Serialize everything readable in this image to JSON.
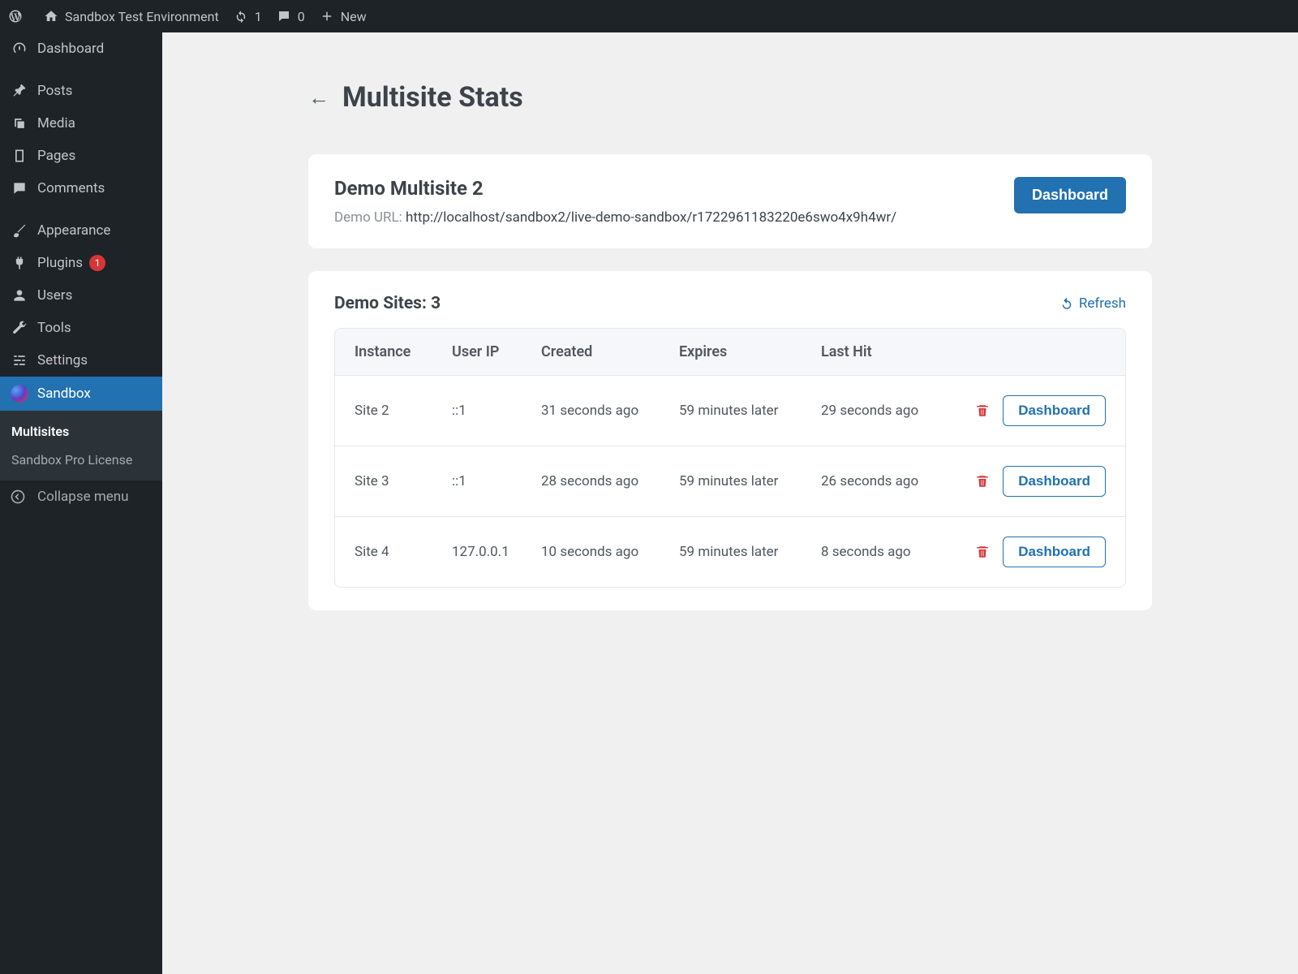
{
  "topbar": {
    "site_name": "Sandbox Test Environment",
    "updates_count": "1",
    "comments_count": "0",
    "new_label": "New"
  },
  "sidebar": {
    "dashboard": "Dashboard",
    "posts": "Posts",
    "media": "Media",
    "pages": "Pages",
    "comments": "Comments",
    "appearance": "Appearance",
    "plugins": "Plugins",
    "plugins_badge": "1",
    "users": "Users",
    "tools": "Tools",
    "settings": "Settings",
    "sandbox": "Sandbox",
    "submenu": {
      "multisites": "Multisites",
      "license": "Sandbox Pro License"
    },
    "collapse": "Collapse menu"
  },
  "page": {
    "title": "Multisite Stats"
  },
  "info_card": {
    "title": "Demo Multisite 2",
    "url_label": "Demo URL:",
    "url": "http://localhost/sandbox2/live-demo-sandbox/r1722961183220e6swo4x9h4wr/",
    "dashboard_btn": "Dashboard"
  },
  "sites_card": {
    "title_prefix": "Demo Sites:",
    "count": "3",
    "refresh": "Refresh",
    "columns": {
      "instance": "Instance",
      "user_ip": "User IP",
      "created": "Created",
      "expires": "Expires",
      "last_hit": "Last Hit"
    },
    "rows": [
      {
        "instance": "Site 2",
        "ip": "::1",
        "created": "31 seconds ago",
        "expires": "59 minutes later",
        "last_hit": "29 seconds ago",
        "dash": "Dashboard"
      },
      {
        "instance": "Site 3",
        "ip": "::1",
        "created": "28 seconds ago",
        "expires": "59 minutes later",
        "last_hit": "26 seconds ago",
        "dash": "Dashboard"
      },
      {
        "instance": "Site 4",
        "ip": "127.0.0.1",
        "created": "10 seconds ago",
        "expires": "59 minutes later",
        "last_hit": "8 seconds ago",
        "dash": "Dashboard"
      }
    ]
  }
}
